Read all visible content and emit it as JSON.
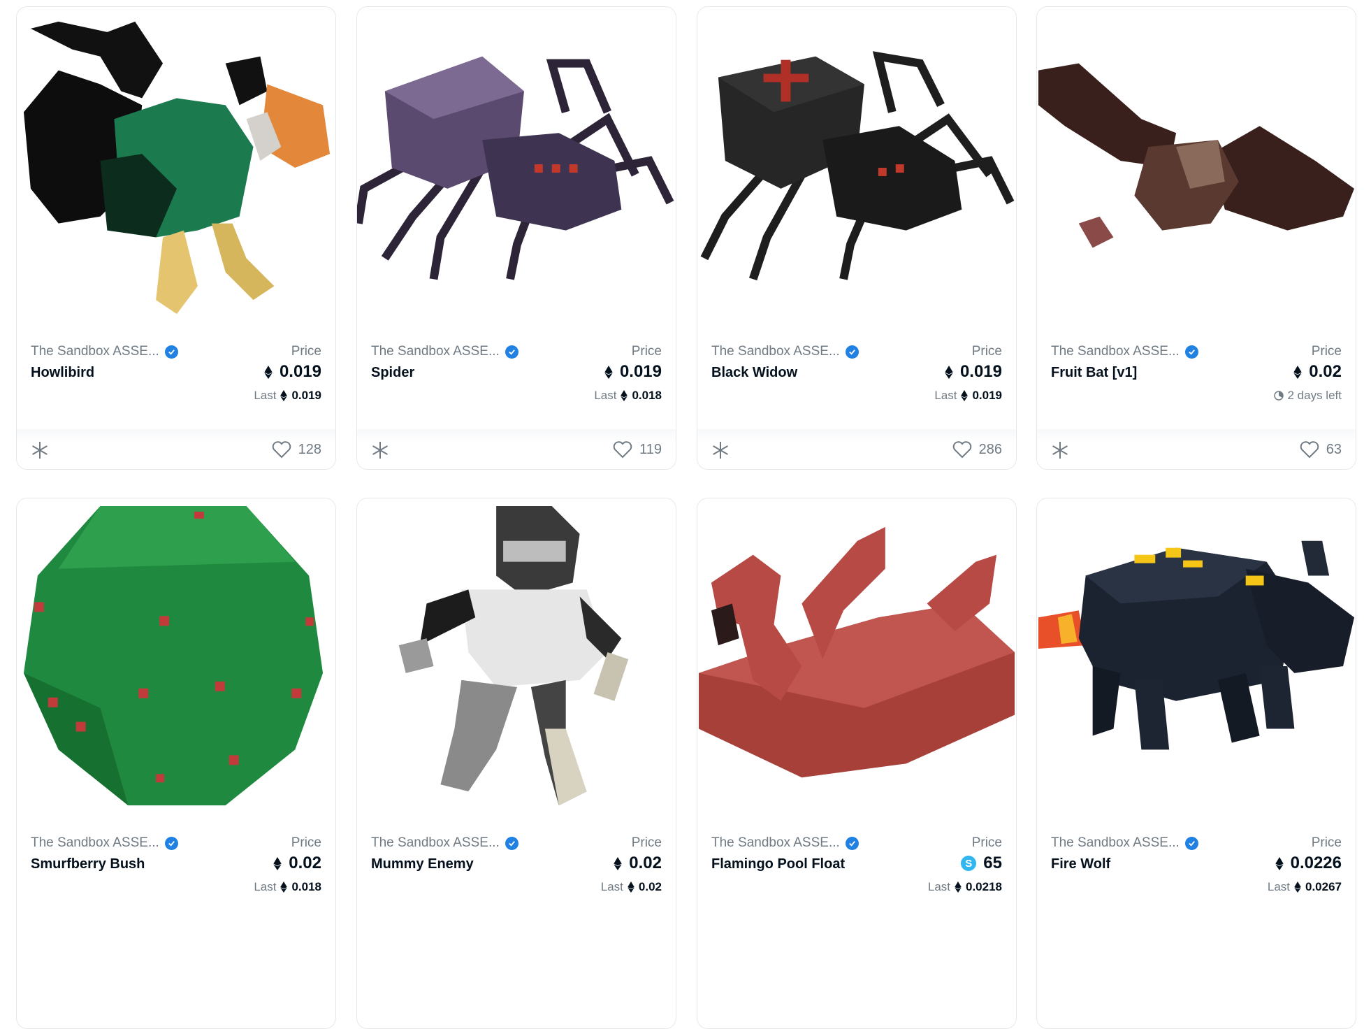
{
  "cards": [
    {
      "collection": "The Sandbox ASSE...",
      "name": "Howlibird",
      "price_label": "Price",
      "price": "0.019",
      "currency": "eth",
      "last_label": "Last",
      "last": "0.019",
      "likes": "128"
    },
    {
      "collection": "The Sandbox ASSE...",
      "name": "Spider",
      "price_label": "Price",
      "price": "0.019",
      "currency": "eth",
      "last_label": "Last",
      "last": "0.018",
      "likes": "119"
    },
    {
      "collection": "The Sandbox ASSE...",
      "name": "Black Widow",
      "price_label": "Price",
      "price": "0.019",
      "currency": "eth",
      "last_label": "Last",
      "last": "0.019",
      "likes": "286"
    },
    {
      "collection": "The Sandbox ASSE...",
      "name": "Fruit Bat [v1]",
      "price_label": "Price",
      "price": "0.02",
      "currency": "eth",
      "time_left": "2 days left",
      "likes": "63"
    },
    {
      "collection": "The Sandbox ASSE...",
      "name": "Smurfberry Bush",
      "price_label": "Price",
      "price": "0.02",
      "currency": "eth",
      "last_label": "Last",
      "last": "0.018"
    },
    {
      "collection": "The Sandbox ASSE...",
      "name": "Mummy Enemy",
      "price_label": "Price",
      "price": "0.02",
      "currency": "eth",
      "last_label": "Last",
      "last": "0.02"
    },
    {
      "collection": "The Sandbox ASSE...",
      "name": "Flamingo Pool Float",
      "price_label": "Price",
      "price": "65",
      "currency": "sand",
      "last_label": "Last",
      "last": "0.0218"
    },
    {
      "collection": "The Sandbox ASSE...",
      "name": "Fire Wolf",
      "price_label": "Price",
      "price": "0.0226",
      "currency": "eth",
      "last_label": "Last",
      "last": "0.0267"
    }
  ],
  "icons": {
    "verified": "verified-badge-icon",
    "eth": "ethereum-icon",
    "sand": "sand-token-icon",
    "freeze": "snowflake-icon",
    "favorite": "heart-icon",
    "timer": "timer-icon"
  },
  "colors": {
    "verified": "#2081e2",
    "sand": "#31b6f0",
    "muted": "#707a83",
    "text": "#04111d",
    "border": "#e5e8eb"
  }
}
